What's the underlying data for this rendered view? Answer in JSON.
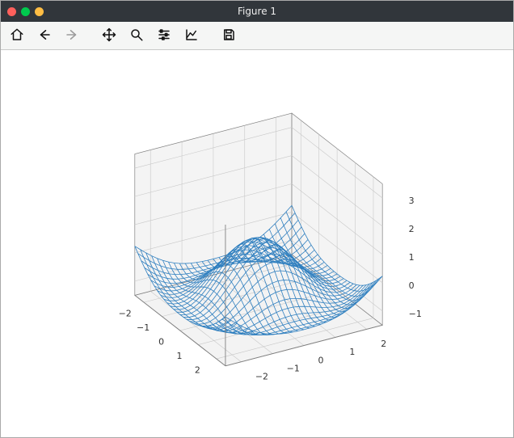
{
  "window": {
    "title": "Figure 1"
  },
  "toolbar": {
    "home": {
      "label": "Home",
      "icon": "home-icon"
    },
    "back": {
      "label": "Back",
      "icon": "arrow-left-icon"
    },
    "forward": {
      "label": "Forward",
      "icon": "arrow-right-icon",
      "disabled": true
    },
    "pan": {
      "label": "Pan",
      "icon": "move-icon"
    },
    "zoom": {
      "label": "Zoom",
      "icon": "search-icon"
    },
    "subplots": {
      "label": "Subplots",
      "icon": "sliders-icon"
    },
    "axes": {
      "label": "Axes options",
      "icon": "chart-line-icon"
    },
    "save": {
      "label": "Save",
      "icon": "save-icon"
    }
  },
  "chart_data": {
    "type": "surface-wireframe-3d",
    "title": "",
    "xlabel": "",
    "ylabel": "",
    "zlabel": "",
    "x_ticks": [
      "−2",
      "−1",
      "0",
      "1",
      "2"
    ],
    "y_ticks": [
      "−2",
      "−1",
      "0",
      "1",
      "2"
    ],
    "z_ticks": [
      "−1",
      "0",
      "1",
      "2",
      "3"
    ],
    "xlim": [
      -2.5,
      2.5
    ],
    "ylim": [
      -2.5,
      2.5
    ],
    "zlim": [
      -1.5,
      3.5
    ],
    "surface": {
      "description": "Wireframe of a radially-symmetric ripple surface (roughly cos(r) shape) with a central peak near z≈1, surrounding trough near z≈−1, and four raised corner lobes near z≈1.",
      "color": "#2f7fbf",
      "x_grid": [
        -2.5,
        -2,
        -1.5,
        -1,
        -0.5,
        0,
        0.5,
        1,
        1.5,
        2,
        2.5
      ],
      "y_grid": [
        -2.5,
        -2,
        -1.5,
        -1,
        -0.5,
        0,
        0.5,
        1,
        1.5,
        2,
        2.5
      ],
      "sample_points": [
        {
          "x": 0,
          "y": 0,
          "z": 1.0
        },
        {
          "x": 1,
          "y": 0,
          "z": 0.0
        },
        {
          "x": -1,
          "y": 0,
          "z": 0.0
        },
        {
          "x": 0,
          "y": 1,
          "z": 0.0
        },
        {
          "x": 0,
          "y": -1,
          "z": 0.0
        },
        {
          "x": 1.5,
          "y": 0,
          "z": -0.9
        },
        {
          "x": -1.5,
          "y": 0,
          "z": -0.9
        },
        {
          "x": 0,
          "y": 1.5,
          "z": -0.9
        },
        {
          "x": 0,
          "y": -1.5,
          "z": -0.9
        },
        {
          "x": 2.5,
          "y": 2.5,
          "z": 1.0
        },
        {
          "x": -2.5,
          "y": 2.5,
          "z": 1.0
        },
        {
          "x": 2.5,
          "y": -2.5,
          "z": 1.0
        },
        {
          "x": -2.5,
          "y": -2.5,
          "z": 1.0
        },
        {
          "x": 2.5,
          "y": 0,
          "z": -0.5
        },
        {
          "x": -2.5,
          "y": 0,
          "z": -0.5
        },
        {
          "x": 0,
          "y": 2.5,
          "z": -0.5
        },
        {
          "x": 0,
          "y": -2.5,
          "z": -0.5
        }
      ]
    },
    "view": {
      "elev": 30,
      "azim": -60,
      "grid": true,
      "background_pane": "#f2f2f2"
    }
  },
  "colors": {
    "wire": "#2f7fbf",
    "axis": "#808080",
    "pane": "#f2f2f2"
  }
}
